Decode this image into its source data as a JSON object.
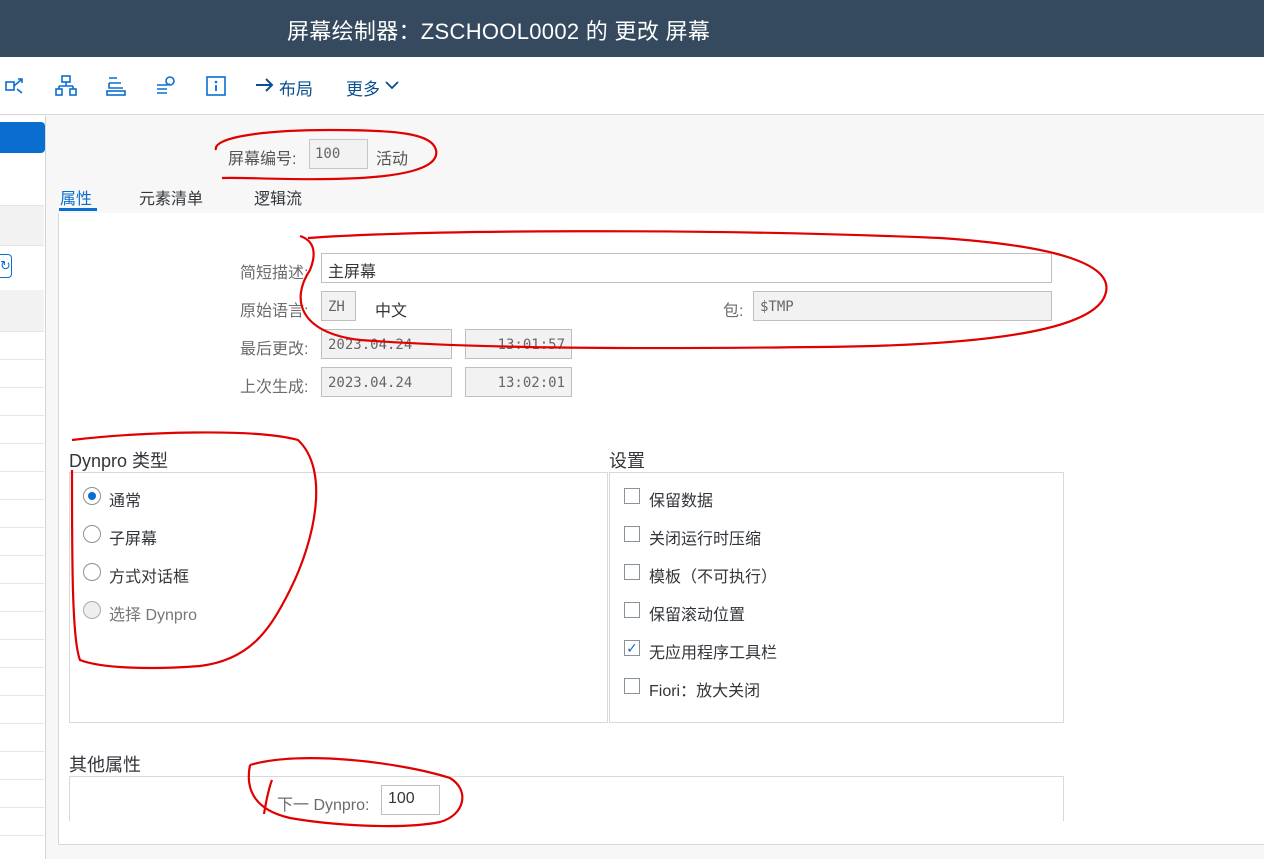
{
  "window": {
    "title": "屏幕绘制器：ZSCHOOL0002 的 更改 屏幕"
  },
  "toolbar": {
    "icons": [
      "link-graph-icon",
      "hierarchy-icon",
      "stack-icon",
      "flowchart-icon",
      "info-icon"
    ],
    "layout_label": "布局",
    "more_label": "更多"
  },
  "header": {
    "screen_number_label": "屏幕编号:",
    "screen_number_value": "100",
    "status": "活动"
  },
  "tabs": [
    {
      "label": "属性",
      "active": true
    },
    {
      "label": "元素清单",
      "active": false
    },
    {
      "label": "逻辑流",
      "active": false
    }
  ],
  "attributes": {
    "short_desc_label": "简短描述:",
    "short_desc_value": "主屏幕",
    "orig_lang_label": "原始语言:",
    "orig_lang_code": "ZH",
    "orig_lang_name": "中文",
    "package_label": "包:",
    "package_value": "$TMP",
    "last_changed_label": "最后更改:",
    "last_changed_date": "2023.04.24",
    "last_changed_time": "13:01:57",
    "last_generated_label": "上次生成:",
    "last_generated_date": "2023.04.24",
    "last_generated_time": "13:02:01"
  },
  "dynpro_type": {
    "title": "Dynpro 类型",
    "options": [
      {
        "label": "通常",
        "checked": true,
        "disabled": false
      },
      {
        "label": "子屏幕",
        "checked": false,
        "disabled": false
      },
      {
        "label": "方式对话框",
        "checked": false,
        "disabled": false
      },
      {
        "label": "选择 Dynpro",
        "checked": false,
        "disabled": true
      }
    ]
  },
  "settings": {
    "title": "设置",
    "options": [
      {
        "label": "保留数据",
        "checked": false
      },
      {
        "label": "关闭运行时压缩",
        "checked": false
      },
      {
        "label": "模板（不可执行）",
        "checked": false
      },
      {
        "label": "保留滚动位置",
        "checked": false
      },
      {
        "label": "无应用程序工具栏",
        "checked": true
      },
      {
        "label": "Fiori：放大关闭",
        "checked": false
      }
    ]
  },
  "other_attributes": {
    "title": "其他属性",
    "next_dynpro_label": "下一 Dynpro:",
    "next_dynpro_value": "100"
  },
  "colors": {
    "accent": "#0a6ed1",
    "titlebar": "#354a5f",
    "annotation": "#e00000"
  }
}
